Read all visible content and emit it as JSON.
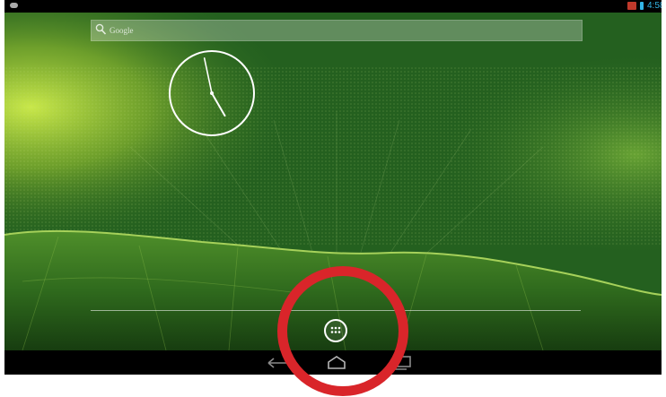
{
  "status_bar": {
    "time": "4:58",
    "icons": [
      "notification-icon",
      "network-icon",
      "battery-icon"
    ]
  },
  "home_screen": {
    "search_bar": {
      "label": "Google",
      "icon": "search-icon"
    },
    "clock_widget": {
      "hour_hand_angle_deg": 150,
      "minute_hand_angle_deg": 348
    },
    "dock": {
      "apps_button_icon": "app-drawer-grid-icon"
    }
  },
  "nav_bar": {
    "buttons": [
      "back",
      "home",
      "recents"
    ]
  },
  "colors": {
    "status_accent": "#33b5e5",
    "highlight": "#d9252a",
    "wallpaper": "#1f5a1c"
  }
}
